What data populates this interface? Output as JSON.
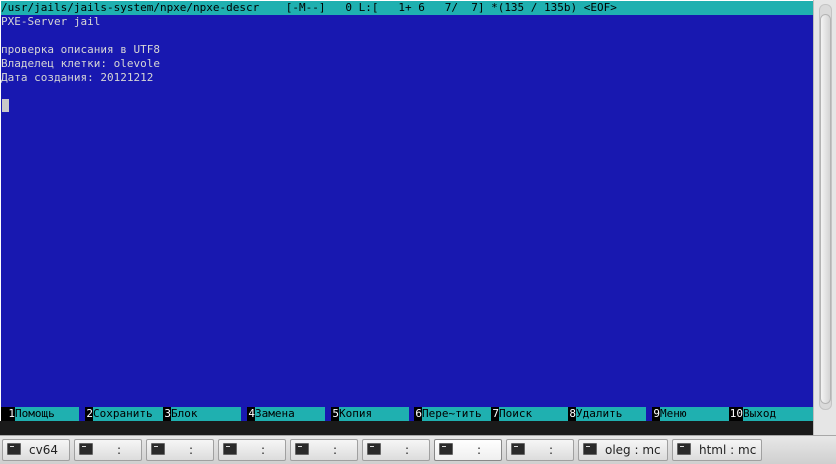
{
  "editor": {
    "status_line": "/usr/jails/jails-system/npxe/npxe-descr    [-M--]   0 L:[   1+ 6   7/  7] *(135 / 135b) <EOF>",
    "lines": [
      "PXE-Server jail",
      "",
      "проверка описания в UTF8",
      "Владелец клетки: olevole",
      "Дата создания: 20121212"
    ]
  },
  "fkeys": [
    {
      "num": "1",
      "label": "Помощь"
    },
    {
      "num": "2",
      "label": "Сохранить"
    },
    {
      "num": "3",
      "label": "Блок"
    },
    {
      "num": "4",
      "label": "Замена"
    },
    {
      "num": "5",
      "label": "Копия"
    },
    {
      "num": "6",
      "label": "Пере~тить"
    },
    {
      "num": "7",
      "label": "Поиск"
    },
    {
      "num": "8",
      "label": "Удалить"
    },
    {
      "num": "9",
      "label": "Меню"
    },
    {
      "num": "10",
      "label": "Выход"
    }
  ],
  "taskbar": {
    "tabs": [
      {
        "label": "cv64",
        "icon": "terminal-icon",
        "active": false
      },
      {
        "label": ":",
        "icon": "terminal-icon",
        "active": false
      },
      {
        "label": ":",
        "icon": "terminal-icon",
        "active": false
      },
      {
        "label": ":",
        "icon": "terminal-icon",
        "active": false
      },
      {
        "label": ":",
        "icon": "terminal-icon",
        "active": false
      },
      {
        "label": ":",
        "icon": "terminal-icon",
        "active": false
      },
      {
        "label": ":",
        "icon": "terminal-icon",
        "active": true
      },
      {
        "label": ":",
        "icon": "terminal-icon",
        "active": false
      },
      {
        "label": "oleg : mc",
        "icon": "terminal-icon",
        "active": false
      },
      {
        "label": "html : mc",
        "icon": "terminal-icon",
        "active": false
      }
    ]
  },
  "colors": {
    "background": "#1818b0",
    "bar": "#1fb0b0",
    "text": "#d6d6d6"
  }
}
